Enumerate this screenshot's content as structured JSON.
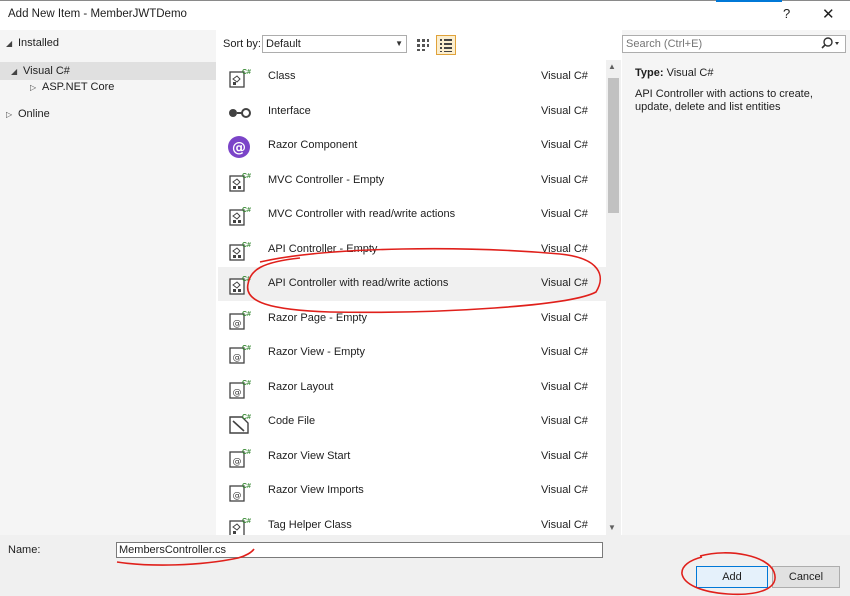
{
  "window": {
    "title": "Add New Item - MemberJWTDemo",
    "help_glyph": "?",
    "close_glyph": "✕"
  },
  "tree": {
    "installed": "Installed",
    "visual_csharp": "Visual C#",
    "aspnet_core": "ASP.NET Core",
    "online": "Online"
  },
  "toolbar": {
    "sort_by_label": "Sort by:",
    "sort_value": "Default"
  },
  "items": [
    {
      "name": "Class",
      "lang": "Visual C#",
      "icon": "class-icon"
    },
    {
      "name": "Interface",
      "lang": "Visual C#",
      "icon": "interface-icon"
    },
    {
      "name": "Razor Component",
      "lang": "Visual C#",
      "icon": "razor-component-icon"
    },
    {
      "name": "MVC Controller - Empty",
      "lang": "Visual C#",
      "icon": "controller-icon"
    },
    {
      "name": "MVC Controller with read/write actions",
      "lang": "Visual C#",
      "icon": "controller-icon"
    },
    {
      "name": "API Controller - Empty",
      "lang": "Visual C#",
      "icon": "controller-icon"
    },
    {
      "name": "API Controller with read/write actions",
      "lang": "Visual C#",
      "icon": "controller-icon",
      "selected": true
    },
    {
      "name": "Razor Page - Empty",
      "lang": "Visual C#",
      "icon": "razor-page-icon"
    },
    {
      "name": "Razor View - Empty",
      "lang": "Visual C#",
      "icon": "razor-view-icon"
    },
    {
      "name": "Razor Layout",
      "lang": "Visual C#",
      "icon": "razor-layout-icon"
    },
    {
      "name": "Code File",
      "lang": "Visual C#",
      "icon": "code-file-icon"
    },
    {
      "name": "Razor View Start",
      "lang": "Visual C#",
      "icon": "razor-view-start-icon"
    },
    {
      "name": "Razor View Imports",
      "lang": "Visual C#",
      "icon": "razor-view-imports-icon"
    },
    {
      "name": "Tag Helper Class",
      "lang": "Visual C#",
      "icon": "tag-helper-icon"
    }
  ],
  "search": {
    "placeholder": "Search (Ctrl+E)"
  },
  "details": {
    "type_label": "Type:",
    "type_value": "Visual C#",
    "description": "API Controller with actions to create, update, delete and list entities"
  },
  "bottom": {
    "name_label": "Name:",
    "name_value": "MembersController.cs",
    "add_label": "Add",
    "cancel_label": "Cancel"
  },
  "colors": {
    "accent": "#0078d7",
    "annotation": "#e0201b",
    "csharp_badge": "#388a34",
    "razor_purple": "#7b44c8"
  }
}
